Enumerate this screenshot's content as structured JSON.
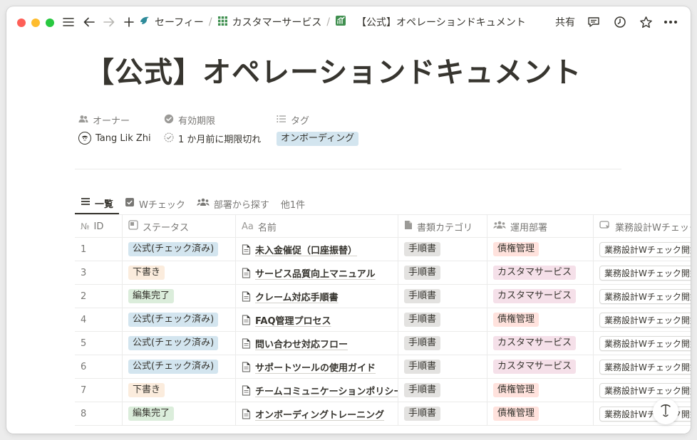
{
  "window": {
    "breadcrumbs": [
      {
        "label": "セーフィー"
      },
      {
        "label": "カスタマーサービス"
      },
      {
        "label": "【公式】オペレーションドキュメント"
      }
    ],
    "share_label": "共有"
  },
  "page": {
    "title": "【公式】オペレーションドキュメント"
  },
  "properties": {
    "owner": {
      "label": "オーナー",
      "value": "Tang Lik Zhi"
    },
    "expiry": {
      "label": "有効期限",
      "value": "1 か月前に期限切れ"
    },
    "tags": {
      "label": "タグ",
      "value": "オンボーディング",
      "color": "#d3e5ef"
    }
  },
  "views": {
    "tabs": [
      {
        "label": "一覧"
      },
      {
        "label": "Wチェック"
      },
      {
        "label": "部署から探す"
      }
    ],
    "more": "他1件"
  },
  "table": {
    "columns": [
      "ID",
      "ステータス",
      "名前",
      "書類カテゴリ",
      "運用部署",
      "業務設計Wチェック"
    ],
    "rows": [
      {
        "id": "1",
        "status": "公式(チェック済み)",
        "name": "未入金催促（口座振替）",
        "category": "手順書",
        "dept": "債権管理",
        "check": "業務設計Wチェック開始"
      },
      {
        "id": "3",
        "status": "下書き",
        "name": "サービス品質向上マニュアル",
        "category": "手順書",
        "dept": "カスタマサービス",
        "check": "業務設計Wチェック開始"
      },
      {
        "id": "2",
        "status": "編集完了",
        "name": "クレーム対応手順書",
        "category": "手順書",
        "dept": "カスタマサービス",
        "check": "業務設計Wチェック開始"
      },
      {
        "id": "4",
        "status": "公式(チェック済み)",
        "name": "FAQ管理プロセス",
        "category": "手順書",
        "dept": "債権管理",
        "check": "業務設計Wチェック開始"
      },
      {
        "id": "5",
        "status": "公式(チェック済み)",
        "name": "問い合わせ対応フロー",
        "category": "手順書",
        "dept": "カスタマサービス",
        "check": "業務設計Wチェック開始"
      },
      {
        "id": "6",
        "status": "公式(チェック済み)",
        "name": "サポートツールの使用ガイド",
        "category": "手順書",
        "dept": "カスタマサービス",
        "check": "業務設計Wチェック開始"
      },
      {
        "id": "7",
        "status": "下書き",
        "name": "チームコミュニケーションポリシー",
        "category": "手順書",
        "dept": "債権管理",
        "check": "業務設計Wチェック開始"
      },
      {
        "id": "8",
        "status": "編集完了",
        "name": "オンボーディングトレーニング",
        "category": "手順書",
        "dept": "債権管理",
        "check": "業務設計Wチェック開始"
      }
    ]
  },
  "colors": {
    "status": {
      "公式(チェック済み)": "#d3e5ef",
      "下書き": "#fbecdd",
      "編集完了": "#dbeddb"
    },
    "category": "#e3e2e0",
    "dept": {
      "債権管理": "#ffe2dd",
      "カスタマサービス": "#f5e0e9"
    }
  },
  "icons": {
    "sidebar": "menu-icon",
    "back": "arrow-left-icon",
    "forward": "arrow-right-icon",
    "new": "plus-icon",
    "comment": "comment-icon",
    "history": "clock-icon",
    "favorite": "star-icon",
    "more": "ellipsis-icon"
  }
}
